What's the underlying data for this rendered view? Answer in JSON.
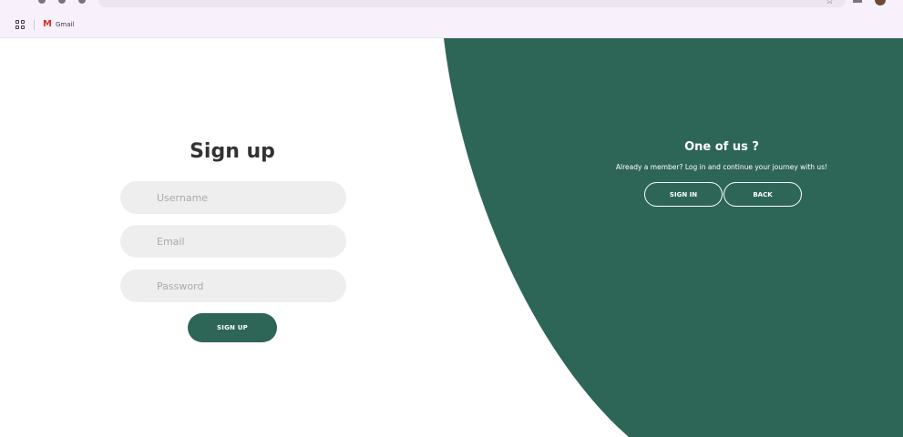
{
  "browser": {
    "bookmarks": [
      {
        "label": "Gmail",
        "icon": "gmail-icon"
      }
    ],
    "apps_icon": "apps-grid-icon"
  },
  "signup_form": {
    "title": "Sign up",
    "username_placeholder": "Username",
    "email_placeholder": "Email",
    "password_placeholder": "Password",
    "submit_label": "SIGN UP"
  },
  "side_panel": {
    "title": "One of us ?",
    "text": "Already a member? Log in and continue your journey with us!",
    "signin_label": "SIGN IN",
    "back_label": "BACK"
  },
  "colors": {
    "accent_green": "#2d6657",
    "field_bg": "#eeeeee",
    "chrome_bg": "#f8f1fb"
  }
}
